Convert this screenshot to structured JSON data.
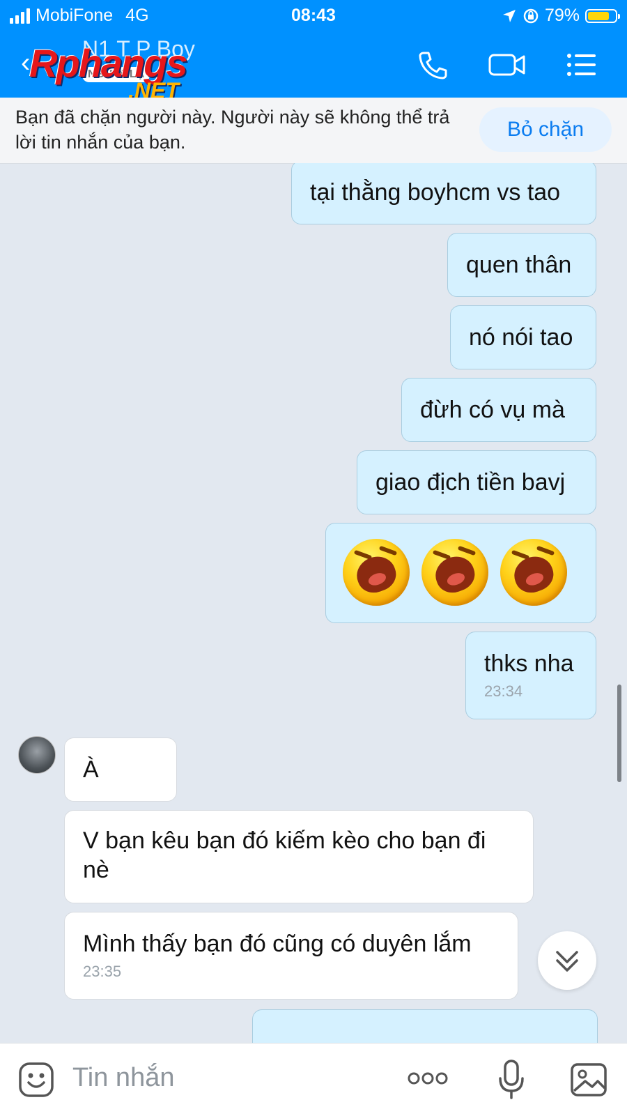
{
  "status_bar": {
    "carrier": "MobiFone",
    "network": "4G",
    "time": "08:43",
    "battery": "79%",
    "battery_level": 0.79
  },
  "header": {
    "contact_name": "N1 T P Boy",
    "stranger_badge": "NGƯỜI LẠ",
    "watermark_line1": "Rphangs",
    "watermark_line2": ".NET",
    "icons": [
      "back-icon",
      "phone-icon",
      "video-call-icon",
      "menu-icon"
    ]
  },
  "block_banner": {
    "message": "Bạn đã chặn người này. Người này sẽ không thể trả lời tin nhắn của bạn.",
    "unblock_label": "Bỏ chặn"
  },
  "messages": [
    {
      "from": "me",
      "text": "tại thằng boyhcm vs tao"
    },
    {
      "from": "me",
      "text": "quen thân"
    },
    {
      "from": "me",
      "text": "nó nói tao"
    },
    {
      "from": "me",
      "text": "đừh có vụ mà"
    },
    {
      "from": "me",
      "text": "giao địch tiền bavj"
    },
    {
      "from": "me",
      "sticker": "laughing-face x3"
    },
    {
      "from": "me",
      "text": "thks nha",
      "time": "23:34"
    },
    {
      "from": "them",
      "text": "À"
    },
    {
      "from": "them",
      "text": "V bạn kêu bạn đó kiếm kèo cho bạn đi nè"
    },
    {
      "from": "them",
      "text": "Mình thấy bạn đó cũng có duyên lắm",
      "time": "23:35"
    }
  ],
  "composer": {
    "placeholder": "Tin nhắn",
    "icons": [
      "sticker-icon",
      "more-icon",
      "microphone-icon",
      "image-icon"
    ]
  },
  "colors": {
    "header_blue": "#0091ff",
    "my_bubble": "#d5f1ff",
    "their_bubble": "#ffffff",
    "chat_bg": "#e2e8f0"
  }
}
